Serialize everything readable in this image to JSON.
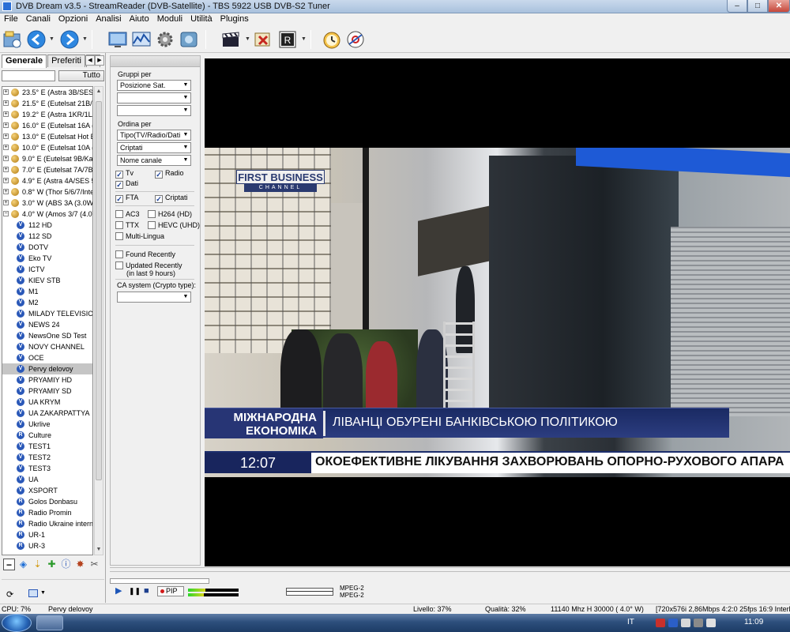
{
  "window": {
    "title": "DVB Dream v3.5  -  StreamReader (DVB-Satellite)  -  TBS 5922 USB DVB-S2 Tuner",
    "min": "–",
    "max": "□",
    "close": "✕"
  },
  "menu": [
    "File",
    "Canali",
    "Opzioni",
    "Analisi",
    "Aiuto",
    "Moduli",
    "Utilità",
    "Plugins"
  ],
  "left": {
    "tabs": [
      "Generale",
      "Preferiti",
      "R"
    ],
    "search_value": "",
    "all_button": "Tutto",
    "satellites": [
      "23.5° E (Astra 3B/SES 1",
      "21.5° E (Eutelsat 21B/Hy",
      "19.2° E (Astra 1KR/1L/1",
      "16.0° E (Eutelsat 16A (1",
      "13.0° E (Eutelsat Hot Bir",
      "10.0° E (Eutelsat 10A (1",
      "9.0° E (Eutelsat 9B/Ka-S",
      "7.0° E (Eutelsat 7A/7B (",
      "4.9° E (Astra 4A/SES 5",
      "0.8° W (Thor 5/6/7/Intels",
      "3.0° W (ABS 3A (3.0W)",
      "4.0° W (Amos 3/7 (4.0W"
    ],
    "channels": [
      {
        "name": "112 HD",
        "type": "V"
      },
      {
        "name": "112 SD",
        "type": "V"
      },
      {
        "name": "DOTV",
        "type": "V"
      },
      {
        "name": "Eko TV",
        "type": "V"
      },
      {
        "name": "ICTV",
        "type": "V"
      },
      {
        "name": "KIEV STB",
        "type": "V"
      },
      {
        "name": "M1",
        "type": "V"
      },
      {
        "name": "M2",
        "type": "V"
      },
      {
        "name": "MILADY TELEVISION",
        "type": "V"
      },
      {
        "name": "NEWS 24",
        "type": "V"
      },
      {
        "name": "NewsOne SD Test",
        "type": "V"
      },
      {
        "name": "NOVY CHANNEL",
        "type": "V"
      },
      {
        "name": "OCE",
        "type": "V"
      },
      {
        "name": "Pervy delovoy",
        "type": "V",
        "selected": true
      },
      {
        "name": "PRYAMIY HD",
        "type": "V"
      },
      {
        "name": "PRYAMIY SD",
        "type": "V"
      },
      {
        "name": "UA KRYM",
        "type": "V"
      },
      {
        "name": "UA ZAKARPATTYA",
        "type": "V"
      },
      {
        "name": "Ukrlive",
        "type": "V"
      },
      {
        "name": "Culture",
        "type": "R"
      },
      {
        "name": "TEST1",
        "type": "V"
      },
      {
        "name": "TEST2",
        "type": "V"
      },
      {
        "name": "TEST3",
        "type": "V"
      },
      {
        "name": "UA",
        "type": "V"
      },
      {
        "name": "XSPORT",
        "type": "V"
      },
      {
        "name": "Golos Donbasu",
        "type": "R"
      },
      {
        "name": "Radio Promin",
        "type": "R"
      },
      {
        "name": "Radio Ukraine internat",
        "type": "R"
      },
      {
        "name": "UR-1",
        "type": "R"
      },
      {
        "name": "UR-3",
        "type": "R"
      }
    ]
  },
  "filter": {
    "group_label": "Gruppi per",
    "group_value": "Posizione Sat.",
    "order_label": "Ordina per",
    "order_values": [
      "Tipo(TV/Radio/Dati",
      "Criptati",
      "Nome canale"
    ],
    "cb_tv": "Tv",
    "cb_radio": "Radio",
    "cb_dati": "Dati",
    "cb_fta": "FTA",
    "cb_criptati": "Criptati",
    "cb_ac3": "AC3",
    "cb_h264": "H264 (HD)",
    "cb_ttx": "TTX",
    "cb_hevc": "HEVC (UHD)",
    "cb_multi": "Multi-Lingua",
    "cb_found": "Found Recently",
    "cb_updated": "Updated Recently",
    "updated_note": "(in last 9 hours)",
    "ca_label": "CA system (Crypto type):"
  },
  "video": {
    "logo_top": "FIRST BUSINESS",
    "logo_bottom": "CHANNEL",
    "banner_left_1": "МІЖНАРОДНА",
    "banner_left_2": "ЕКОНОМІКА",
    "banner_main": "ЛІВАНЦІ ОБУРЕНІ БАНКІВСЬКОЮ ПОЛІТИКОЮ",
    "clock": "12:07",
    "ticker": "ОКОЕФЕКТИВНЕ ЛІКУВАННЯ ЗАХВОРЮВАНЬ ОПОРНО-РУХОВОГО АПАРА"
  },
  "controls": {
    "play": "▶",
    "pause": "❚❚",
    "stop": "■",
    "pip": "PIP",
    "codec_video": "MPEG-2",
    "codec_audio": "MPEG-2"
  },
  "status": {
    "cpu": "CPU: 7%",
    "channel": "Pervy delovoy",
    "level": "Livello: 37%",
    "quality": "Qualità: 32%",
    "tuning": "11140 Mhz  H  30000  ( 4.0° W)",
    "stream": "[720x576i  2,86Mbps 4:2:0 25fps 16:9 Interla"
  },
  "taskbar": {
    "lang": "IT",
    "time": "11:09"
  }
}
